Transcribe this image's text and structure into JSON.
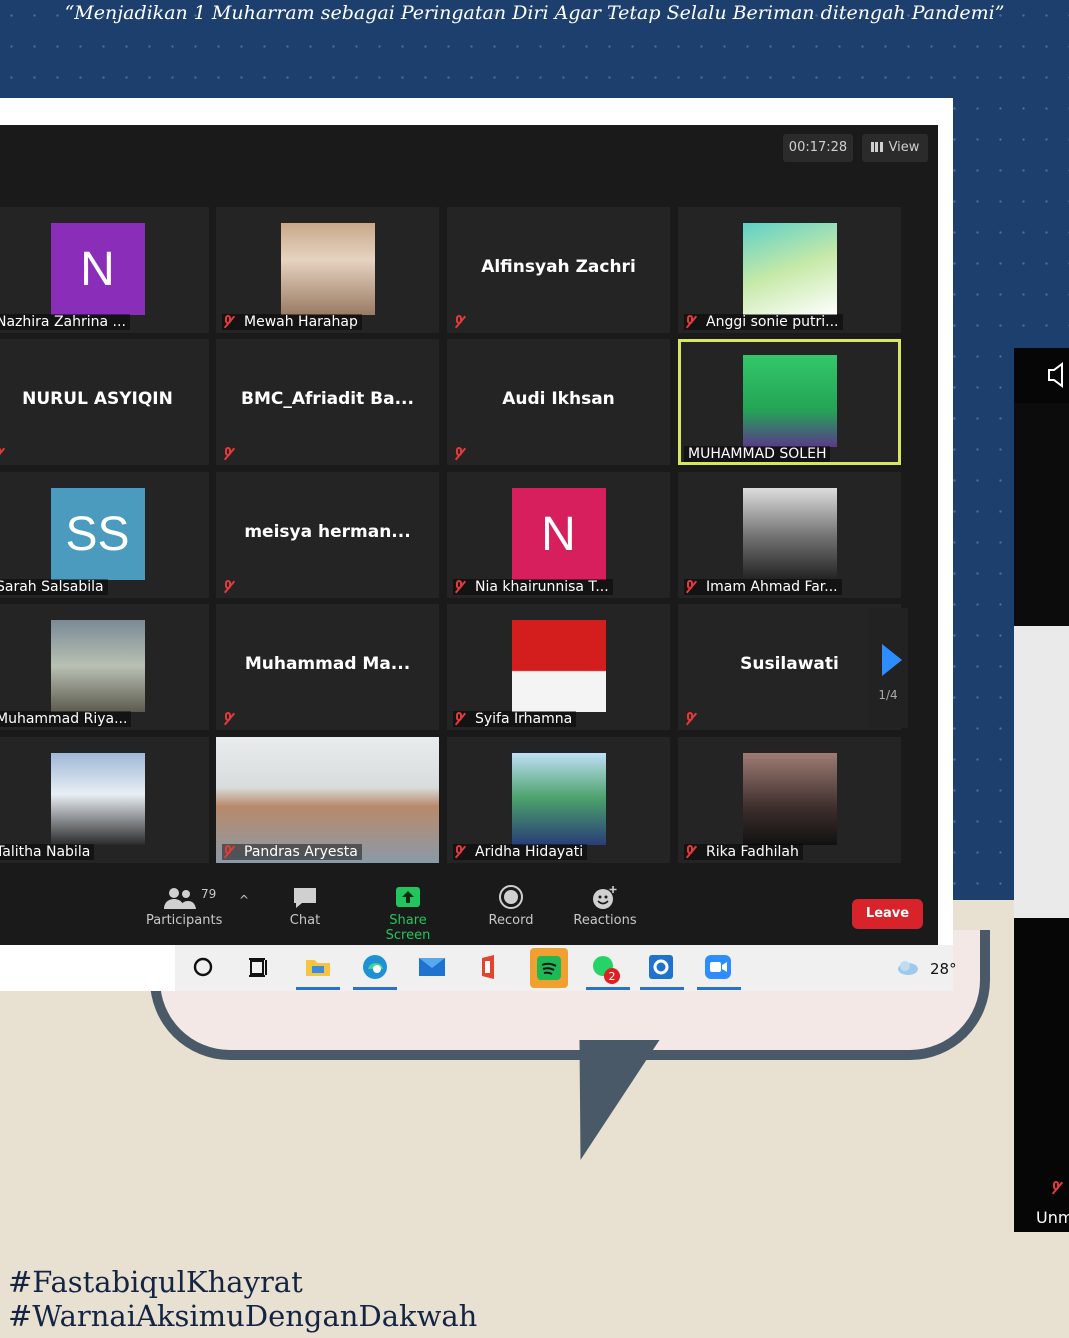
{
  "banner": {
    "quote": "“Menjadikan 1 Muharram sebagai Peringatan Diri Agar Tetap Selalu Beriman ditengah Pandemi”"
  },
  "meeting": {
    "timer": "00:17:28",
    "view_label": "View",
    "page_indicator": "1/4",
    "participants": [
      {
        "name": "Nazhira Zahrina ...",
        "type": "avatar",
        "initials": "N",
        "avatar_color": "#8a2db8",
        "muted": false
      },
      {
        "name": "Mewah Harahap",
        "type": "photo",
        "muted": true
      },
      {
        "name": "Alfinsyah Zachri",
        "type": "name",
        "muted": true
      },
      {
        "name": "Anggi sonie putri...",
        "type": "photo",
        "muted": true
      },
      {
        "name": "NURUL ASYIQIN",
        "type": "name",
        "muted": true
      },
      {
        "name": "BMC_Afriadit  Ba...",
        "type": "name",
        "muted": true
      },
      {
        "name": "Audi Ikhsan",
        "type": "name",
        "muted": true
      },
      {
        "name": "MUHAMMAD SOLEH",
        "type": "photo",
        "muted": false,
        "active": true
      },
      {
        "name": "Sarah Salsabila",
        "type": "avatar",
        "initials": "SS",
        "avatar_color": "#4a9bbd",
        "muted": false
      },
      {
        "name": "meisya  herman...",
        "type": "name",
        "muted": true
      },
      {
        "name": "Nia khairunnisa T...",
        "type": "avatar",
        "initials": "N",
        "avatar_color": "#d81f5e",
        "muted": true
      },
      {
        "name": "Imam Ahmad Far...",
        "type": "photo",
        "muted": true
      },
      {
        "name": "Muhammad Riya...",
        "type": "photo",
        "muted": false
      },
      {
        "name": "Muhammad  Ma...",
        "type": "name",
        "muted": true
      },
      {
        "name": "Syifa Irhamna",
        "type": "photo",
        "muted": true
      },
      {
        "name": "Susilawati",
        "type": "name",
        "muted": true
      },
      {
        "name": "Talitha Nabila",
        "type": "photo",
        "muted": false
      },
      {
        "name": "Pandras Aryesta",
        "type": "video",
        "muted": true
      },
      {
        "name": "Aridha Hidayati",
        "type": "photo",
        "muted": true
      },
      {
        "name": "Rika Fadhilah",
        "type": "photo",
        "muted": true
      }
    ],
    "toolbar": {
      "participants_label": "Participants",
      "participants_count": "79",
      "chat_label": "Chat",
      "share_label": "Share Screen",
      "record_label": "Record",
      "reactions_label": "Reactions",
      "leave_label": "Leave"
    }
  },
  "taskbar": {
    "weather": "28°",
    "badge_count": "2"
  },
  "side_panel": {
    "label": "Unm"
  },
  "hashtags": {
    "line1": "#FastabiqulKhayrat",
    "line2": "#WarnaiAksimuDenganDakwah"
  },
  "colors": {
    "background_navy": "#1d3f6e",
    "zoom_bg": "#1a1a1a",
    "active_border": "#d8e85a",
    "leave_red": "#d8232a",
    "share_green": "#23c55e",
    "arrow_blue": "#2d8cff"
  }
}
